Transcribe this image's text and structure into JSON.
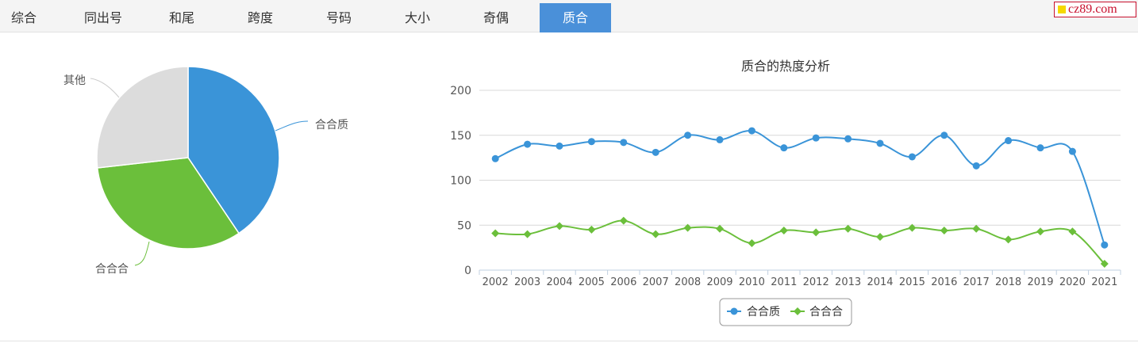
{
  "tabs": [
    {
      "label": "综合",
      "active": false
    },
    {
      "label": "同出号",
      "active": false
    },
    {
      "label": "和尾",
      "active": false
    },
    {
      "label": "跨度",
      "active": false
    },
    {
      "label": "号码",
      "active": false
    },
    {
      "label": "大小",
      "active": false
    },
    {
      "label": "奇偶",
      "active": false
    },
    {
      "label": "质合",
      "active": true
    }
  ],
  "brand": {
    "text": "cz89.com"
  },
  "colors": {
    "blue": "#3a94d8",
    "green": "#6bbf3b",
    "grey": "#dcdcdc"
  },
  "chart_data": [
    {
      "type": "pie",
      "slices": [
        {
          "label": "合合质",
          "value": 40.6,
          "color": "#3a94d8"
        },
        {
          "label": "合合合",
          "value": 32.6,
          "color": "#6bbf3b"
        },
        {
          "label": "其他",
          "value": 26.8,
          "color": "#dcdcdc"
        }
      ]
    },
    {
      "type": "line",
      "title": "质合的热度分析",
      "x": [
        "2002",
        "2003",
        "2004",
        "2005",
        "2006",
        "2007",
        "2008",
        "2009",
        "2010",
        "2011",
        "2012",
        "2013",
        "2014",
        "2015",
        "2016",
        "2017",
        "2018",
        "2019",
        "2020",
        "2021"
      ],
      "series": [
        {
          "name": "合合质",
          "color": "#3a94d8",
          "marker": "circle",
          "values": [
            124,
            140,
            138,
            143,
            142,
            131,
            150,
            145,
            155,
            136,
            147,
            146,
            141,
            126,
            150,
            116,
            144,
            136,
            132,
            28
          ]
        },
        {
          "name": "合合合",
          "color": "#6bbf3b",
          "marker": "diamond",
          "values": [
            41,
            40,
            49,
            45,
            55,
            40,
            47,
            46,
            30,
            44,
            42,
            46,
            37,
            47,
            44,
            46,
            34,
            43,
            43,
            7
          ]
        }
      ],
      "ylim": [
        0,
        200
      ],
      "yticks": [
        0,
        50,
        100,
        150,
        200
      ],
      "grid": true,
      "legend": "bottom-center"
    }
  ]
}
